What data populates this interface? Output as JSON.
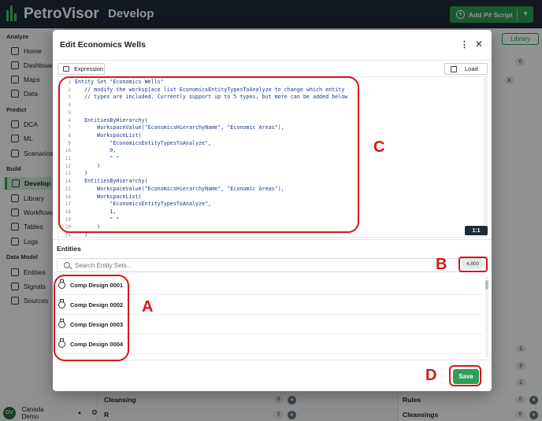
{
  "app": {
    "brand": "PetroVisor",
    "page_title": "Develop",
    "add_button": "Add P# Script",
    "library_button": "Library"
  },
  "sidebar": {
    "sections": [
      {
        "title": "Analyze",
        "items": [
          "Home",
          "Dashboards",
          "Maps",
          "Data"
        ]
      },
      {
        "title": "Predict",
        "items": [
          "DCA",
          "ML",
          "Scenarios"
        ]
      },
      {
        "title": "Build",
        "items": [
          "Develop",
          "Library",
          "Workflows",
          "Tables",
          "Logs"
        ]
      },
      {
        "title": "Data Model",
        "items": [
          "Entities",
          "Signals",
          "Sources"
        ]
      }
    ],
    "footer": {
      "avatar": "GV",
      "workspace": "Canada Demo"
    }
  },
  "background_rows": {
    "bottom_left": [
      {
        "label": "Cleansing",
        "count": "0"
      },
      {
        "label": "R",
        "count": "2"
      }
    ],
    "bottom_right": [
      {
        "label": "Rules",
        "count": "0"
      },
      {
        "label": "Cleansings",
        "count": "0"
      }
    ],
    "right_counts": [
      "0",
      "6",
      "1",
      "0",
      "2",
      "0"
    ]
  },
  "modal": {
    "title": "Edit Economics Wells",
    "expression_tab": "Expression",
    "load_button": "Load",
    "zoom_badge": "1:1",
    "code_lines": [
      "Entity Set \"Economics Wells\"",
      "   // modify the worksp[ace list EconomicsEntityTypesToAnalyze to change which entity",
      "   // types are included. Currently support up to 5 types, but more can be added below",
      "",
      "",
      "   EntitiesByHierarchy(",
      "       WorkspaceValue(\"EconomicsHierarchyName\", \"Economic Areas\"),",
      "       WorkspaceList(",
      "           \"EconomicsEntityTypesToAnalyze\",",
      "           0,",
      "           \" \"",
      "       )",
      "   )",
      "   EntitiesByHierarchy(",
      "       WorkspaceValue(\"EconomicsHierarchyName\", \"Economic Areas\"),",
      "       WorkspaceList(",
      "           \"EconomicsEntityTypesToAnalyze\",",
      "           1,",
      "           \" \"",
      "       )",
      "   )"
    ],
    "entities_label": "Entities",
    "search_placeholder": "Search Entity Sets...",
    "entity_count": "4,800",
    "entities": [
      "Comp Design 0001",
      "Comp Design 0002",
      "Comp Design 0003",
      "Comp Design 0004"
    ],
    "save_button": "Save"
  },
  "annotations": {
    "a": "A",
    "b": "B",
    "c": "C",
    "d": "D"
  },
  "colors": {
    "accent": "#2e9e55",
    "annotation": "#d7141a",
    "topbar": "#1f2a36"
  }
}
